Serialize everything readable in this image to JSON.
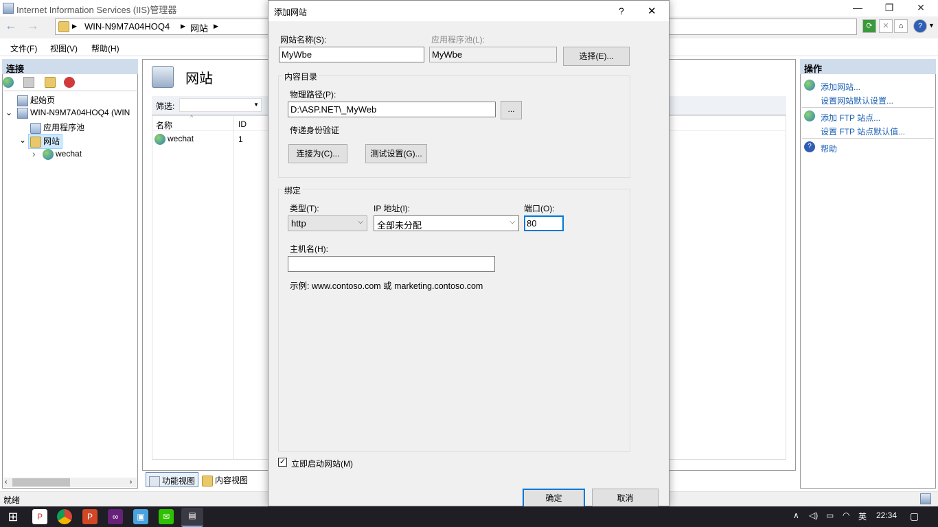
{
  "window": {
    "title": "Internet Information Services (IIS)管理器",
    "minimize": "—",
    "maximize": "❐",
    "close": "✕"
  },
  "address": {
    "back": "←",
    "forward": "→",
    "crumbs": [
      "WIN-N9M7A04HOQ4",
      "网站"
    ],
    "sep": "▶"
  },
  "menu": [
    "文件(F)",
    "视图(V)",
    "帮助(H)"
  ],
  "left": {
    "header": "连接",
    "tree": [
      "起始页",
      "WIN-N9M7A04HOQ4 (WIN",
      "应用程序池",
      "网站",
      "wechat"
    ],
    "expanders": [
      "⌄",
      "⌄",
      "›"
    ]
  },
  "center": {
    "title": "网站",
    "filter_label": "筛选:",
    "columns": [
      "名称",
      "ID"
    ],
    "rows": [
      {
        "name": "wechat",
        "id": "1"
      }
    ],
    "tabs": [
      "功能视图",
      "内容视图"
    ]
  },
  "right": {
    "header": "操作",
    "actions": [
      "添加网站...",
      "设置网站默认设置...",
      "添加 FTP 站点...",
      "设置 FTP 站点默认值...",
      "帮助"
    ]
  },
  "status": "就绪",
  "dialog": {
    "title": "添加网站",
    "help": "?",
    "close": "✕",
    "site_name_label": "网站名称(S):",
    "site_name_value": "MyWbe",
    "app_pool_label": "应用程序池(L):",
    "app_pool_value": "MyWbe",
    "select_button": "选择(E)...",
    "content_group": "内容目录",
    "physical_path_label": "物理路径(P):",
    "physical_path_value": "D:\\ASP.NET\\_MyWeb",
    "browse_button": "...",
    "passthrough_label": "传递身份验证",
    "connect_as_button": "连接为(C)...",
    "test_settings_button": "测试设置(G)...",
    "binding_group": "绑定",
    "type_label": "类型(T):",
    "type_value": "http",
    "ip_label": "IP 地址(I):",
    "ip_value": "全部未分配",
    "port_label": "端口(O):",
    "port_value": "80",
    "hostname_label": "主机名(H):",
    "hostname_value": "",
    "example_text": "示例: www.contoso.com 或 marketing.contoso.com",
    "start_checkbox_label": "立即启动网站(M)",
    "start_checked": true,
    "ok_button": "确定",
    "cancel_button": "取消"
  },
  "taskbar": {
    "apps": [
      "start-icon",
      "p-icon",
      "chrome-icon",
      "powerpoint-icon",
      "visual-studio-icon",
      "app-icon",
      "wechat-icon",
      "iis-icon"
    ],
    "tray": {
      "lang": "英",
      "time": "22:34"
    }
  }
}
